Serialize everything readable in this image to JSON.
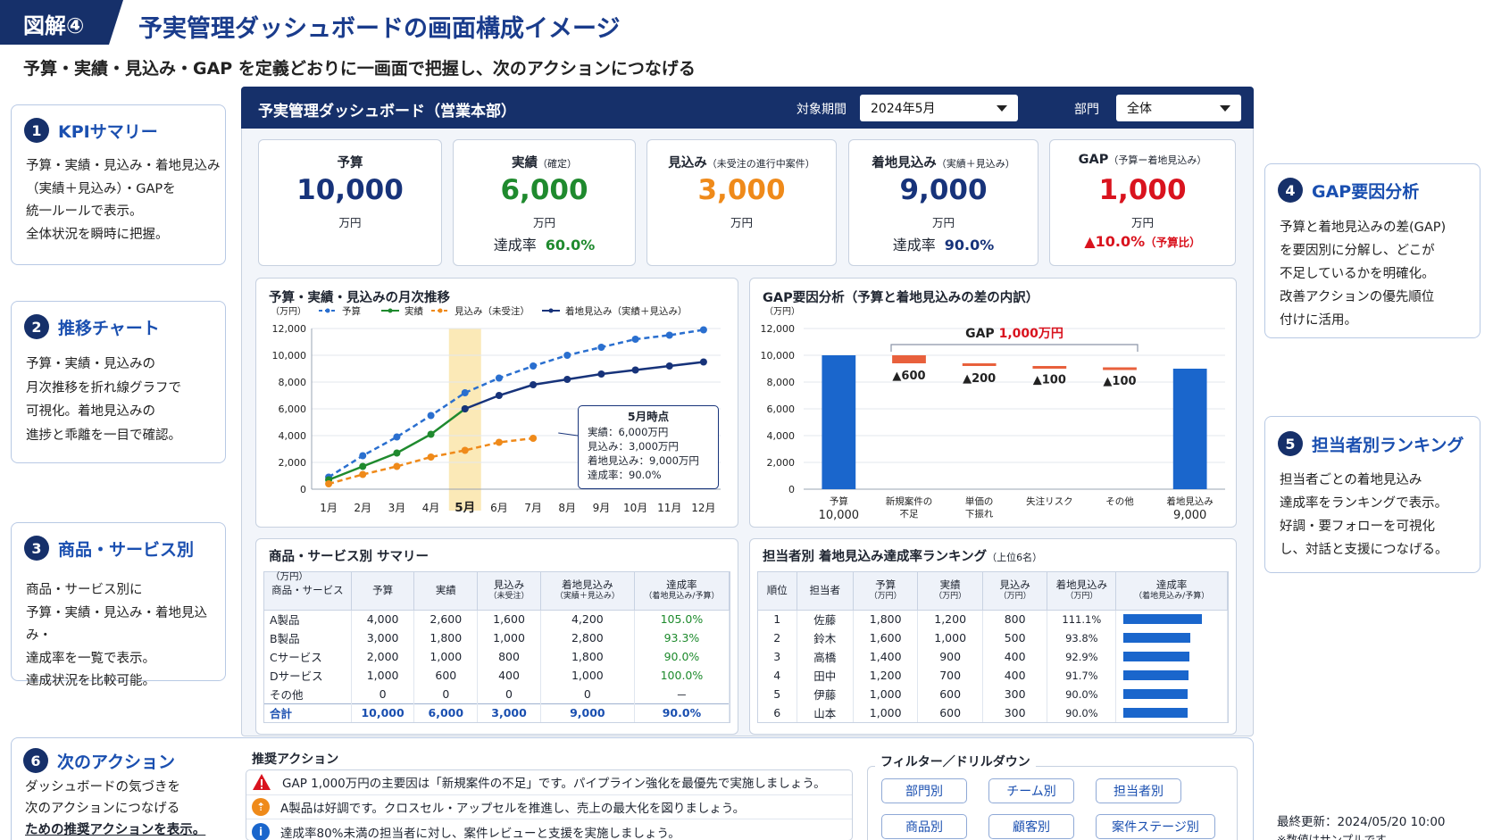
{
  "header": {
    "figure_tag": "図解④",
    "title": "予実管理ダッシュボードの画面構成イメージ",
    "subtitle": "予算・実績・見込み・GAP を定義どおりに一画面で把握し、次のアクションにつなげる"
  },
  "side": [
    {
      "num": "1",
      "title": "KPIサマリー",
      "body": "予算・実績・見込み・着地見込み\n（実績＋見込み）・GAPを\n統一ルールで表示。\n全体状況を瞬時に把握。"
    },
    {
      "num": "2",
      "title": "推移チャート",
      "body": "予算・実績・見込みの\n月次推移を折れ線グラフで\n可視化。着地見込みの\n進捗と乖離を一目で確認。"
    },
    {
      "num": "3",
      "title": "商品・サービス別",
      "body": "商品・サービス別に\n予算・実績・見込み・着地見込み・\n達成率を一覧で表示。\n達成状況を比較可能。"
    },
    {
      "num": "4",
      "title": "GAP要因分析",
      "body": "予算と着地見込みの差(GAP)\nを要因別に分解し、どこが\n不足しているかを明確化。\n改善アクションの優先順位\n付けに活用。"
    },
    {
      "num": "5",
      "title": "担当者別ランキング",
      "body": "担当者ごとの着地見込み\n達成率をランキングで表示。\n好調・要フォローを可視化\nし、対話と支援につなげる。"
    },
    {
      "num": "6",
      "title": "次のアクション",
      "body": "ダッシュボードの気づきを\n次のアクションにつなげる"
    }
  ],
  "side6_underlined": "ための推奨アクションを表示。",
  "dashboard": {
    "title": "予実管理ダッシュボード（営業本部）",
    "period_label": "対象期間",
    "period_value": "2024年5月",
    "dept_label": "部門",
    "dept_value": "全体"
  },
  "kpis": [
    {
      "label": "予算",
      "sub": "",
      "value": "10,000",
      "unit": "万円",
      "rate_label": "",
      "rate": "",
      "color": "#17337a"
    },
    {
      "label": "実績",
      "sub": "（確定）",
      "value": "6,000",
      "unit": "万円",
      "rate_label": "達成率",
      "rate": "60.0%",
      "color": "#1f8a2e"
    },
    {
      "label": "見込み",
      "sub": "（未受注の進行中案件）",
      "value": "3,000",
      "unit": "万円",
      "rate_label": "",
      "rate": "",
      "color": "#ef8a1a"
    },
    {
      "label": "着地見込み",
      "sub": "（実績＋見込み）",
      "value": "9,000",
      "unit": "万円",
      "rate_label": "達成率",
      "rate": "90.0%",
      "color": "#17337a"
    },
    {
      "label": "GAP",
      "sub": "（予算ー着地見込み）",
      "value": "1,000",
      "unit": "万円",
      "rate_label": "",
      "rate": "▲10.0%",
      "rate_note": "（予算比）",
      "color": "#d9131e"
    }
  ],
  "trend": {
    "title": "予算・実績・見込みの月次推移",
    "unit": "（万円）",
    "legend": [
      "予算",
      "実績",
      "見込み（未受注）",
      "着地見込み（実績＋見込み）"
    ],
    "tooltip": {
      "title": "5月時点",
      "lines": [
        "実績：6,000万円",
        "見込み：3,000万円",
        "着地見込み：9,000万円",
        "達成率：90.0%"
      ]
    }
  },
  "chart_data": [
    {
      "type": "line",
      "title": "予算・実績・見込みの月次推移",
      "ylabel": "（万円）",
      "ylim": [
        0,
        12000
      ],
      "categories": [
        "1月",
        "2月",
        "3月",
        "4月",
        "5月",
        "6月",
        "7月",
        "8月",
        "9月",
        "10月",
        "11月",
        "12月"
      ],
      "highlight": "5月",
      "series": [
        {
          "name": "予算",
          "color": "#2a6fcf",
          "dashed": true,
          "values": [
            900,
            2500,
            3900,
            5500,
            7200,
            8300,
            9200,
            10000,
            10600,
            11200,
            11500,
            11900
          ]
        },
        {
          "name": "実績",
          "color": "#1f8a2e",
          "dashed": false,
          "values": [
            700,
            1700,
            2700,
            4100,
            6000,
            null,
            null,
            null,
            null,
            null,
            null,
            null
          ]
        },
        {
          "name": "見込み（未受注）",
          "color": "#ef8a1a",
          "dashed": true,
          "values": [
            400,
            1100,
            1700,
            2400,
            2900,
            3500,
            3800,
            null,
            null,
            null,
            null,
            null
          ]
        },
        {
          "name": "着地見込み（実績＋見込み）",
          "color": "#17337a",
          "dashed": false,
          "values": [
            null,
            null,
            null,
            null,
            6000,
            7000,
            7800,
            8200,
            8600,
            8900,
            9200,
            9500
          ]
        }
      ]
    },
    {
      "type": "bar",
      "subtype": "waterfall",
      "title": "GAP要因分析（予算と着地見込みの差の内訳）",
      "ylabel": "（万円）",
      "ylim": [
        0,
        12000
      ],
      "categories": [
        "予算",
        "新規案件の不足",
        "単価の下振れ",
        "失注リスク",
        "その他",
        "着地見込み"
      ],
      "values": [
        10000,
        -600,
        -200,
        -100,
        -100,
        9000
      ],
      "bar_labels": [
        "10,000",
        "▲600",
        "▲200",
        "▲100",
        "▲100",
        "9,000"
      ],
      "annotation": {
        "prefix": "GAP",
        "value": "1,000万円"
      }
    }
  ],
  "gap": {
    "title": "GAP要因分析（予算と着地見込みの差の内訳）",
    "unit": "（万円）",
    "bracket_prefix": "GAP",
    "bracket_value": "1,000万円",
    "xl": [
      [
        "予算"
      ],
      [
        "新規案件の",
        "不足"
      ],
      [
        "単価の",
        "下振れ"
      ],
      [
        "失注リスク"
      ],
      [
        "その他"
      ],
      [
        "着地見込み"
      ]
    ],
    "xv": [
      "10,000",
      "",
      "",
      "",
      "",
      "9,000"
    ]
  },
  "product": {
    "title": "商品・サービス別 サマリー",
    "unit": "（万円）",
    "headers": [
      [
        "商品・サービス",
        ""
      ],
      [
        "予算",
        ""
      ],
      [
        "実績",
        ""
      ],
      [
        "見込み",
        "（未受注）"
      ],
      [
        "着地見込み",
        "（実績＋見込み）"
      ],
      [
        "達成率",
        "（着地見込み/予算）"
      ]
    ],
    "rows": [
      [
        "A製品",
        "4,000",
        "2,600",
        "1,600",
        "4,200",
        "105.0%"
      ],
      [
        "B製品",
        "3,000",
        "1,800",
        "1,000",
        "2,800",
        "93.3%"
      ],
      [
        "Cサービス",
        "2,000",
        "1,000",
        "800",
        "1,800",
        "90.0%"
      ],
      [
        "Dサービス",
        "1,000",
        "600",
        "400",
        "1,000",
        "100.0%"
      ],
      [
        "その他",
        "0",
        "0",
        "0",
        "0",
        "－"
      ]
    ],
    "total": [
      "合計",
      "10,000",
      "6,000",
      "3,000",
      "9,000",
      "90.0%"
    ]
  },
  "ranking": {
    "title": "担当者別 着地見込み達成率ランキング",
    "title_note": "（上位6名）",
    "headers": [
      [
        "順位",
        ""
      ],
      [
        "担当者",
        ""
      ],
      [
        "予算",
        "（万円）"
      ],
      [
        "実績",
        "（万円）"
      ],
      [
        "見込み",
        "（万円）"
      ],
      [
        "着地見込み",
        "（万円）"
      ],
      [
        "達成率",
        "（着地見込み/予算）"
      ]
    ],
    "rows": [
      [
        "1",
        "佐藤",
        "1,800",
        "1,200",
        "800",
        "111.1%"
      ],
      [
        "2",
        "鈴木",
        "1,600",
        "1,000",
        "500",
        "93.8%"
      ],
      [
        "3",
        "高橋",
        "1,400",
        "900",
        "400",
        "92.9%"
      ],
      [
        "4",
        "田中",
        "1,200",
        "700",
        "400",
        "91.7%"
      ],
      [
        "5",
        "伊藤",
        "1,000",
        "600",
        "300",
        "90.0%"
      ],
      [
        "6",
        "山本",
        "1,000",
        "600",
        "300",
        "90.0%"
      ]
    ],
    "rates": [
      111.1,
      93.8,
      92.9,
      91.7,
      90.0,
      90.0
    ],
    "bar_color": "#1a66cc"
  },
  "actions": {
    "title": "推奨アクション",
    "items": [
      {
        "icon": "warning-icon",
        "color": "#d9131e",
        "text": "GAP 1,000万円の主要因は「新規案件の不足」です。パイプライン強化を最優先で実施しましょう。"
      },
      {
        "icon": "upsell-icon",
        "color": "#ef8a1a",
        "text": "A製品は好調です。クロスセル・アップセルを推進し、売上の最大化を図りましょう。"
      },
      {
        "icon": "info-icon",
        "color": "#1a66cc",
        "text": "達成率80%未満の担当者に対し、案件レビューと支援を実施しましょう。"
      }
    ]
  },
  "filters": {
    "title": "フィルター／ドリルダウン",
    "buttons": [
      "部門別",
      "チーム別",
      "担当者別",
      "商品別",
      "顧客別",
      "案件ステージ別"
    ]
  },
  "footer": {
    "updated": "最終更新：2024/05/20 10:00",
    "note": "※数値はサンプルです"
  }
}
